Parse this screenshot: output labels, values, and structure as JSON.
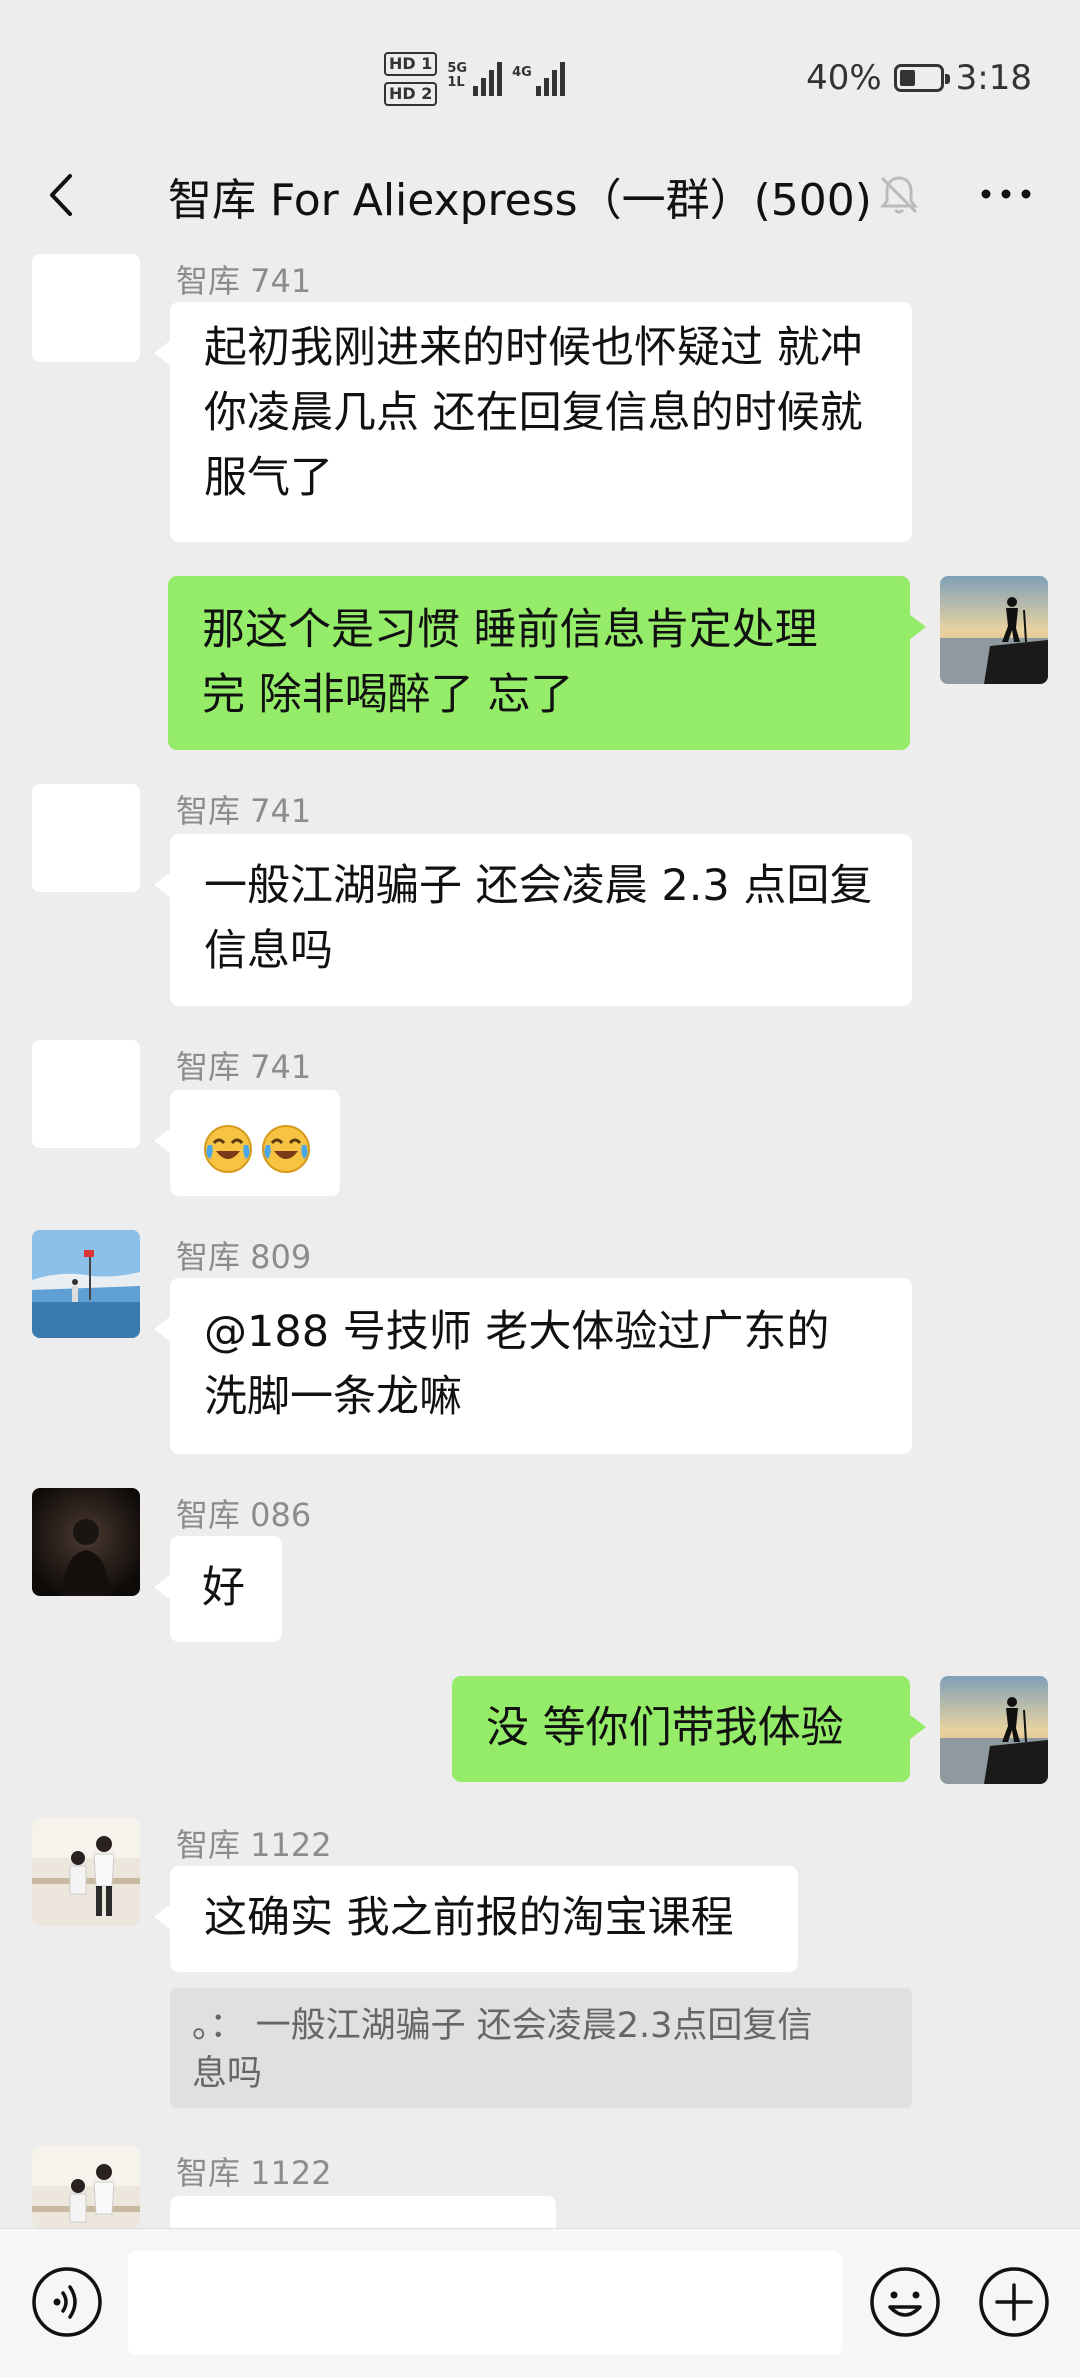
{
  "status_bar": {
    "hd1": "HD 1",
    "hd2": "HD 2",
    "net1_top": "5G",
    "net1_bottom": "1L",
    "net2": "4G",
    "battery": "40%",
    "battery_level": 0.4,
    "time": "3:18"
  },
  "header": {
    "title": "智库 For Aliexpress（一群）(500)"
  },
  "messages": [
    {
      "sender": "智库 741",
      "lines": [
        "起初我刚进来的时候也怀疑过 就冲",
        "你凌晨几点 还在回复信息的时候就",
        "服气了"
      ]
    },
    {
      "lines": [
        "那这个是习惯 睡前信息肯定处理",
        "完 除非喝醉了 忘了"
      ]
    },
    {
      "sender": "智库 741",
      "lines": [
        "一般江湖骗子 还会凌晨 2.3 点回复",
        "信息吗"
      ]
    },
    {
      "sender": "智库 741",
      "emojis": [
        "face-with-tears-of-joy",
        "face-with-tears-of-joy"
      ]
    },
    {
      "sender": "智库 809",
      "lines": [
        "@188 号技师  老大体验过广东的",
        "洗脚一条龙嘛"
      ]
    },
    {
      "sender": "智库 086",
      "lines": [
        "好"
      ]
    },
    {
      "lines": [
        "没  等你们带我体验"
      ]
    },
    {
      "sender": "智库 1122",
      "lines": [
        "这确实 我之前报的淘宝课程"
      ],
      "quote_lines": [
        "。：  一般江湖骗子 还会凌晨2.3点回复信",
        "息吗"
      ]
    },
    {
      "sender": "智库 1122"
    }
  ],
  "colors": {
    "background": "#ededed",
    "self_bubble": "#95ec69",
    "other_bubble": "#ffffff"
  }
}
